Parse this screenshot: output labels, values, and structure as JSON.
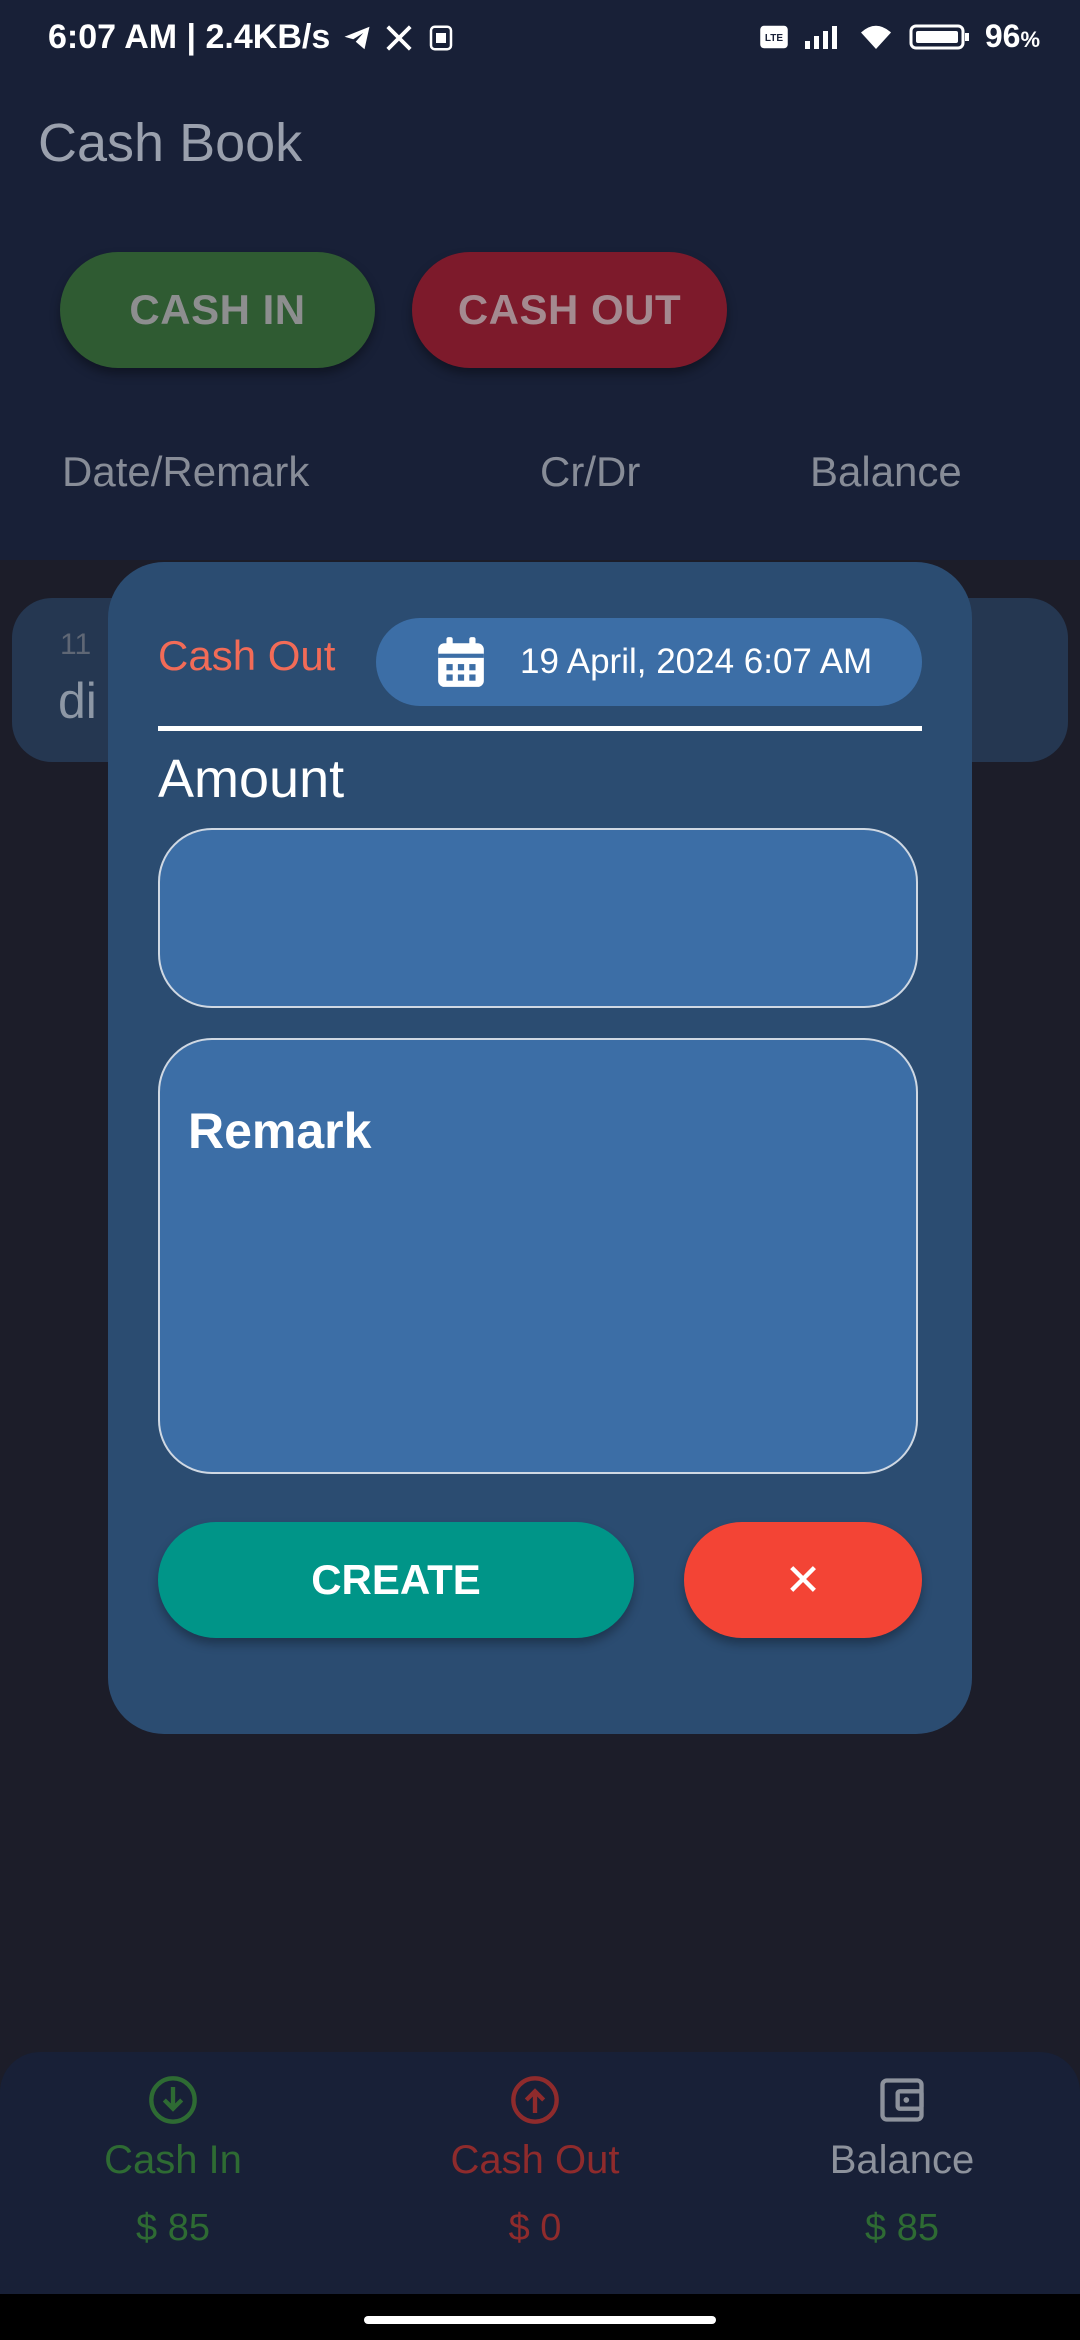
{
  "status_bar": {
    "left_text": "6:07 AM | 2.4KB/s",
    "battery": "96",
    "battery_unit": "%",
    "icons": [
      "telegram-icon",
      "x-icon",
      "sim-icon",
      "volte-icon",
      "signal-icon",
      "wifi-icon",
      "battery-icon"
    ]
  },
  "app": {
    "title": "Cash Book",
    "cash_in_label": "CASH IN",
    "cash_out_label": "CASH OUT",
    "columns": [
      "Date/Remark",
      "Cr/Dr",
      "Balance"
    ]
  },
  "list": {
    "first_item_date": "11",
    "first_item_title": "di"
  },
  "dialog": {
    "type_label": "Cash Out",
    "date_text": "19 April, 2024 6:07 AM",
    "amount_label": "Amount",
    "amount_value": "",
    "remark_placeholder": "Remark",
    "create_label": "CREATE",
    "close_label": "✕"
  },
  "bottom_bar": {
    "cash_in": {
      "label": "Cash In",
      "value": "$ 85",
      "color": "#2e6b33"
    },
    "cash_out": {
      "label": "Cash Out",
      "value": "$ 0",
      "color": "#8f2b2c"
    },
    "balance": {
      "label": "Balance",
      "value": "$ 85",
      "color": "#2e6b33",
      "label_color": "#8d929c"
    }
  },
  "colors": {
    "accent_teal": "#009588",
    "accent_red": "#f34435",
    "cash_out_text": "#f26b57"
  }
}
